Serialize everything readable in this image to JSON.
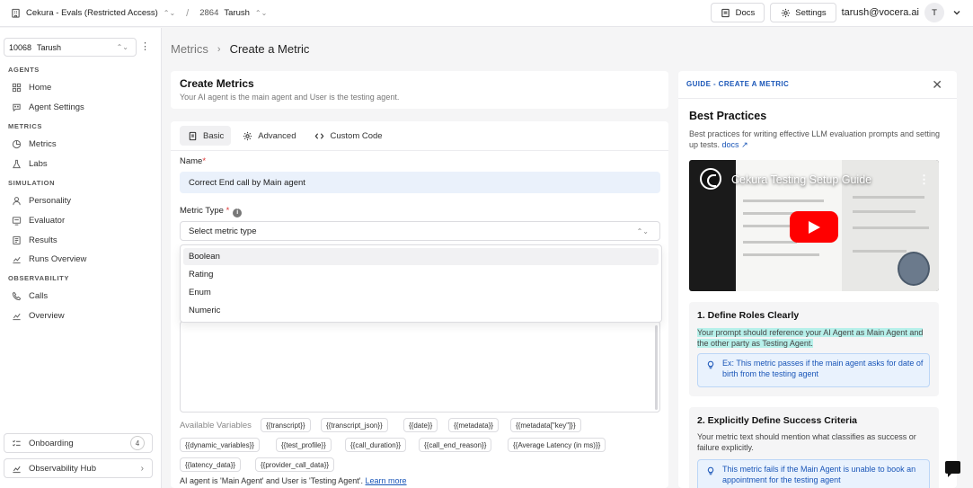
{
  "topbar": {
    "project": "Cekura - Evals (Restricted Access)",
    "separator": "/",
    "agent_id": "2864",
    "agent_name": "Tarush",
    "docs_label": "Docs",
    "settings_label": "Settings",
    "user_email": "tarush@vocera.ai",
    "avatar_initial": "T"
  },
  "sidebar": {
    "org_id": "10068",
    "org_name": "Tarush",
    "sections": {
      "agents": "AGENTS",
      "metrics": "METRICS",
      "simulation": "SIMULATION",
      "observability": "OBSERVABILITY"
    },
    "items": {
      "home": "Home",
      "agent_settings": "Agent Settings",
      "metrics": "Metrics",
      "labs": "Labs",
      "personality": "Personality",
      "evaluator": "Evaluator",
      "results": "Results",
      "runs_overview": "Runs Overview",
      "calls": "Calls",
      "overview": "Overview"
    },
    "onboarding_label": "Onboarding",
    "onboarding_count": "4",
    "observability_hub_label": "Observability Hub"
  },
  "breadcrumb": {
    "parent": "Metrics",
    "current": "Create a Metric"
  },
  "header": {
    "title": "Create Metrics",
    "subtitle": "Your AI agent is the main agent and User is the testing agent."
  },
  "form": {
    "tabs": [
      "Basic",
      "Advanced",
      "Custom Code"
    ],
    "name_label": "Name",
    "name_value": "Correct End call by Main agent",
    "metric_type_label": "Metric Type",
    "metric_type_placeholder": "Select metric type",
    "metric_type_options": [
      "Boolean",
      "Rating",
      "Enum",
      "Numeric"
    ],
    "available_variables_label": "Available Variables",
    "variables": [
      "{{transcript}}",
      "{{transcript_json}}",
      "{{date}}",
      "{{metadata}}",
      "{{metadata[\"key\"]}}",
      "{{dynamic_variables}}",
      "{{test_profile}}",
      "{{call_duration}}",
      "{{call_end_reason}}",
      "{{Average Latency (in ms)}}",
      "{{latency_data}}",
      "{{provider_call_data}}"
    ],
    "footnote": "AI agent is 'Main Agent' and User is 'Testing Agent'.",
    "footnote_link": "Learn more"
  },
  "guide": {
    "header": "GUIDE - CREATE A METRIC",
    "title": "Best Practices",
    "description": "Best practices for writing effective LLM evaluation prompts and setting up tests.",
    "docs_link": "docs",
    "video_title": "Cekura Testing Setup Guide",
    "section1_title": "1. Define Roles Clearly",
    "section1_text": "Your prompt should reference your AI Agent as Main Agent and the other party as Testing Agent.",
    "section1_tip": "Ex: This metric passes if the main agent asks for date of birth from the testing agent",
    "section2_title": "2. Explicitly Define Success Criteria",
    "section2_text": "Your metric text should mention what classifies as success or failure explicitly.",
    "section2_tip": "This metric fails if the Main Agent is unable to book an appointment for the testing agent"
  },
  "colors": {
    "accent": "#1a56b8",
    "highlight": "#b7f0ea",
    "input_bg": "#eaf1fb",
    "play_red": "#ff0000"
  }
}
